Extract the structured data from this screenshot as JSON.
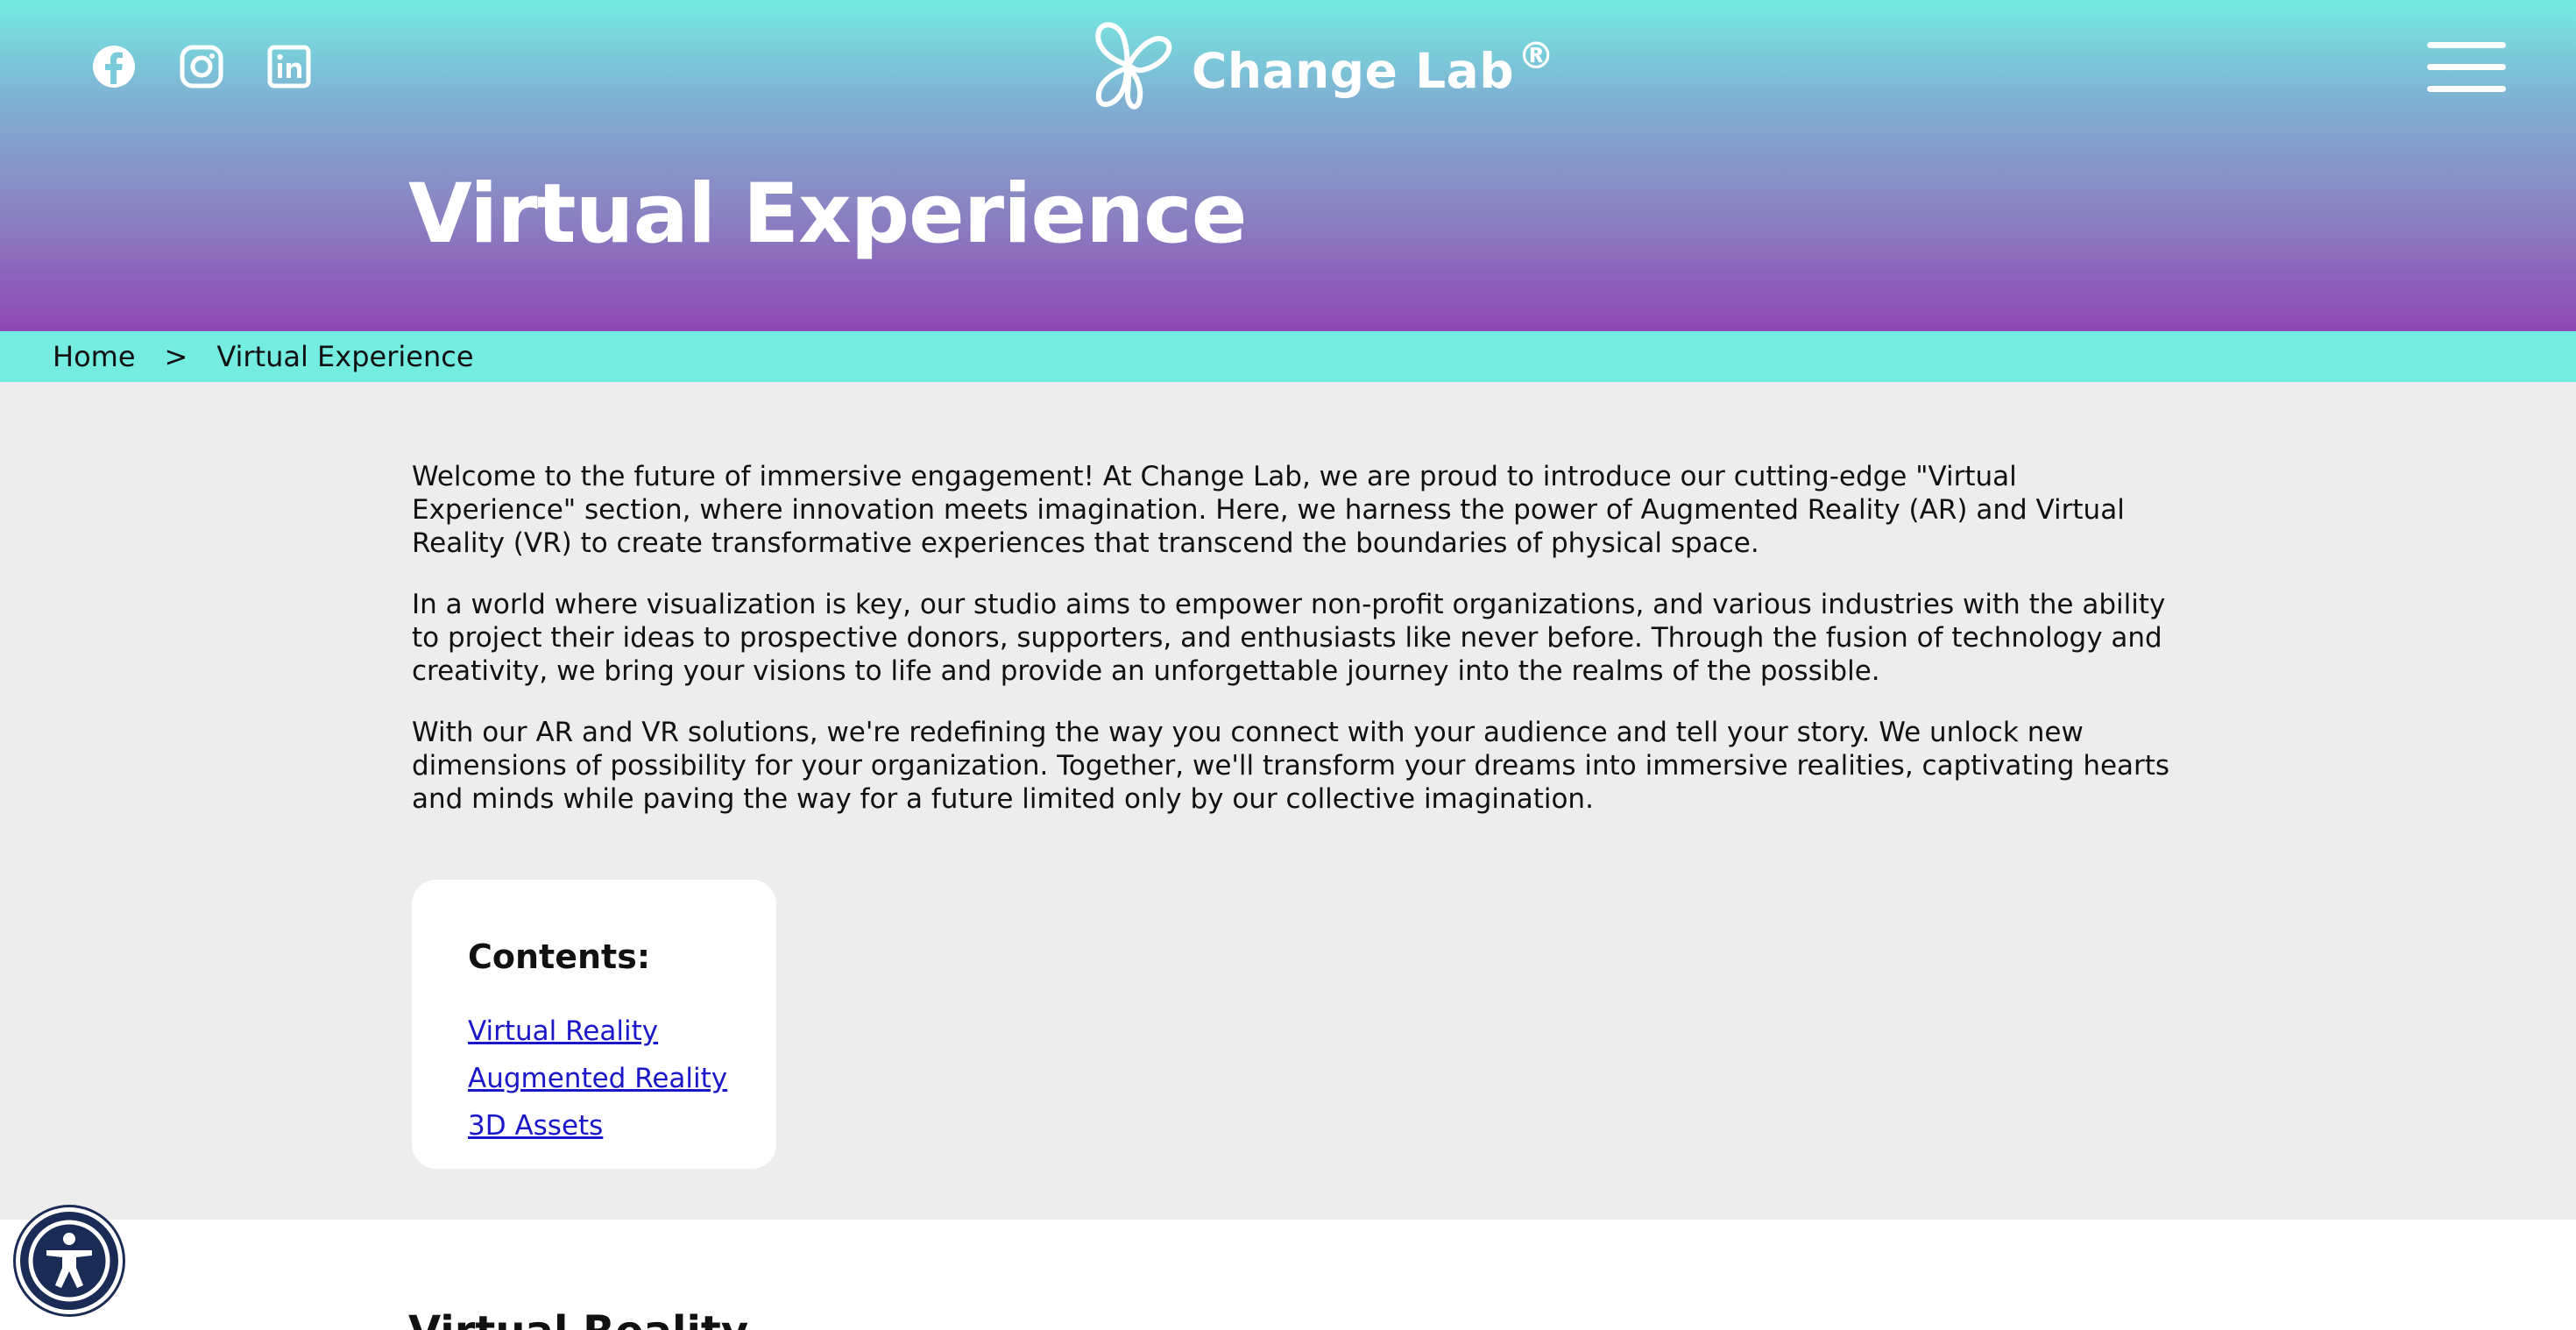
{
  "header": {
    "socials": [
      {
        "name": "facebook-icon"
      },
      {
        "name": "instagram-icon"
      },
      {
        "name": "linkedin-icon"
      }
    ],
    "brand": {
      "name": "Change Lab",
      "reg": "®"
    },
    "menu_icon": "hamburger-menu-icon",
    "page_title": "Virtual Experience",
    "colors": {
      "gradient_top": "#74ece2",
      "gradient_bottom": "#8e47b4",
      "breadcrumb_bg": "#74ece0",
      "link": "#1a17c9"
    }
  },
  "breadcrumb": {
    "home": "Home",
    "separator": ">",
    "current": "Virtual Experience"
  },
  "intro": {
    "paragraphs": [
      "Welcome to the future of immersive engagement! At Change Lab, we are proud to introduce our cutting-edge \"Virtual Experience\" section, where innovation meets imagination. Here, we harness the power of Augmented Reality (AR) and Virtual Reality (VR) to create transformative experiences that transcend the boundaries of physical space.",
      "In a world where visualization is key, our studio aims to empower non-profit organizations, and various industries with the ability to project their ideas to prospective donors, supporters, and enthusiasts like never before. Through the fusion of technology and creativity, we bring your visions to life and provide an unforgettable journey into the realms of the possible.",
      "With our AR and VR solutions, we're redefining the way you connect with your audience and tell your story. We unlock new dimensions of possibility for your organization. Together, we'll transform your dreams into immersive realities, captivating hearts and minds while paving the way for a future limited only by our collective imagination."
    ]
  },
  "toc": {
    "title": "Contents:",
    "links": [
      "Virtual Reality",
      "Augmented Reality",
      "3D Assets"
    ]
  },
  "section": {
    "heading": "Virtual Reality"
  },
  "accessibility": {
    "icon": "accessibility-icon"
  }
}
